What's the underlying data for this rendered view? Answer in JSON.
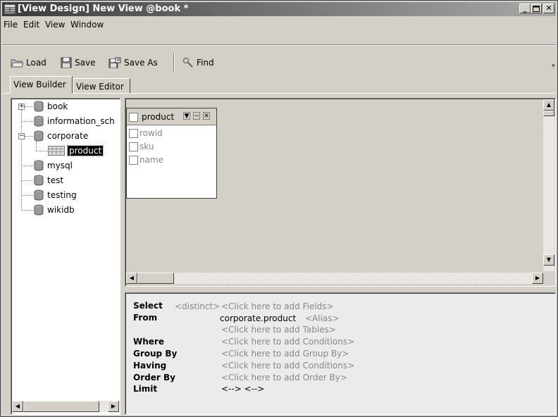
{
  "window": {
    "title": "[View Design] New View @book *"
  },
  "menu": [
    "File",
    "Edit",
    "View",
    "Window"
  ],
  "toolbar": {
    "load": "Load",
    "save": "Save",
    "save_as": "Save As",
    "find": "Find"
  },
  "tabs": {
    "builder": "View Builder",
    "editor": "View Editor"
  },
  "tree": {
    "items": [
      {
        "label": "book",
        "icon": "database-icon"
      },
      {
        "label": "information_sch",
        "icon": "database-icon"
      },
      {
        "label": "corporate",
        "icon": "database-icon"
      },
      {
        "label": "product",
        "icon": "table-icon"
      },
      {
        "label": "mysql",
        "icon": "database-icon"
      },
      {
        "label": "test",
        "icon": "database-icon"
      },
      {
        "label": "testing",
        "icon": "database-icon"
      },
      {
        "label": "wikidb",
        "icon": "database-icon"
      }
    ]
  },
  "design_table": {
    "name": "product",
    "fields": [
      "rowid",
      "sku",
      "name"
    ]
  },
  "sql": {
    "select_label": "Select",
    "distinct": "<distinct>",
    "add_fields": "<Click here to add Fields>",
    "from_label": "From",
    "from_table": "corporate.product",
    "alias": "<Alias>",
    "add_tables": "<Click here to add Tables>",
    "where_label": "Where",
    "add_conditions": "<Click here to add Conditions>",
    "group_by_label": "Group By",
    "add_group_by": "<Click here to add Group By>",
    "having_label": "Having",
    "add_having": "<Click here to add Conditions>",
    "order_by_label": "Order By",
    "add_order_by": "<Click here to add Order By>",
    "limit_label": "Limit",
    "limit_value": "<--> <-->"
  }
}
